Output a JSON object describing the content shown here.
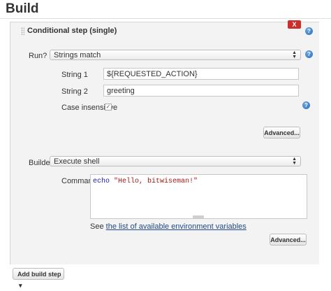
{
  "page": {
    "heading": "Build"
  },
  "section": {
    "title": "Conditional step (single)",
    "delete_label": "X",
    "help": "?"
  },
  "run": {
    "label": "Run?",
    "selected": "Strings match",
    "string1_label": "String 1",
    "string1_value": "${REQUESTED_ACTION}",
    "string2_label": "String 2",
    "string2_value": "greeting",
    "case_label": "Case insensitive",
    "case_checked": "✓",
    "advanced_label": "Advanced..."
  },
  "builder": {
    "label": "Builder",
    "selected": "Execute shell",
    "command_label": "Command",
    "command_keyword": "echo",
    "command_string": "\"Hello, bitwiseman!\"",
    "see_prefix": "See",
    "env_link": "the list of available environment variables",
    "advanced_label": "Advanced..."
  },
  "footer": {
    "add_step_label": "Add build step",
    "add_step_arrow": "▾"
  },
  "colors": {
    "delete": "#c9302c",
    "help": "#2a6fba",
    "command_keyword": "#1a1aa6",
    "command_string": "#a31515",
    "link": "#204a87"
  },
  "icons": [
    "drag-handle-icon",
    "help-icon",
    "updown-arrows-icon",
    "checkmark-icon",
    "dropdown-arrow-icon"
  ]
}
